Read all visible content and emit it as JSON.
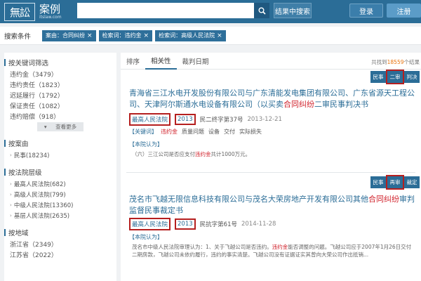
{
  "header": {
    "logo_mark": "無訟",
    "logo_name": "案例",
    "logo_url": "itslaw.com",
    "search_value": "",
    "search_in_label": "结果中搜索",
    "login_label": "登录",
    "register_label": "注册"
  },
  "conditions": {
    "label": "搜索条件",
    "tags": [
      "案由：合同纠纷",
      "检索词：违约金",
      "检索词：高级人民法院"
    ]
  },
  "sidebar": {
    "keyword_section": "按关键词筛选",
    "keywords": [
      "违约金（3479）",
      "违约责任（1823）",
      "迟延履行（1792）",
      "保证责任（1082）",
      "违约赔偿（918）"
    ],
    "more_label": "查看更多",
    "cause_section": "按案由",
    "causes": [
      "民事(18234)"
    ],
    "court_section": "按法院层级",
    "courts": [
      "最高人民法院(682)",
      "高级人民法院(799)",
      "中级人民法院(13360)",
      "基层人民法院(2635)"
    ],
    "region_section": "按地域",
    "regions": [
      "浙江省（2349）",
      "江苏省（2022）"
    ]
  },
  "results": {
    "tabs": [
      "排序",
      "相关性",
      "裁判日期"
    ],
    "total_prefix": "共找到",
    "total_count": "18559",
    "total_suffix": "个结果",
    "cases": [
      {
        "badges": [
          "民事",
          "二审",
          "判决"
        ],
        "highlight_badge": 1,
        "title_pre": "青海省三江水电开发股份有限公司与广东清能发电集团有限公司、广东省源天工程公司、天津阿尔斯通水电设备有限公司（以买卖",
        "title_red": "合同纠纷",
        "title_post": "二审民事判决书",
        "court": "最高人民法院",
        "year": "2013",
        "case_no": "民二终字第37号",
        "date": "2013-12-21",
        "kw_label": "【关键词】",
        "keywords": [
          "违约金",
          "质量问题",
          "设备",
          "交付",
          "实际损失"
        ],
        "court_view_label": "【本院认为】",
        "snippet_pre": "（六）三江公司是否应支付",
        "snippet_red": "违约金",
        "snippet_post": "共计1000万元。"
      },
      {
        "badges": [
          "民事",
          "再审",
          "裁定"
        ],
        "highlight_badge": 1,
        "title_pre": "茂名市飞越无限信息科技有限公司与茂名大荣房地产开发有限公司其他",
        "title_red": "合同纠纷",
        "title_post": "审判监督民事裁定书",
        "court": "最高人民法院",
        "year": "2013",
        "case_no": "民抗字第61号",
        "date": "2014-11-28",
        "court_view_label": "【本院认为】",
        "snippet_pre": "茂名市中级人民法院审理认为：1、关于飞越公司是否违约。",
        "snippet_red": "违约金",
        "snippet_post": "能否调整的问题。飞越公司应于2007年1月26日交付二期房款，飞越公司未依约履行，违约的事实清楚。飞越公司没有证据证实其曾向大荣公司作出抵销..."
      }
    ]
  },
  "colors": {
    "brand": "#2b6d97",
    "highlight": "#d0202a",
    "annotation": "#b51f1f"
  }
}
